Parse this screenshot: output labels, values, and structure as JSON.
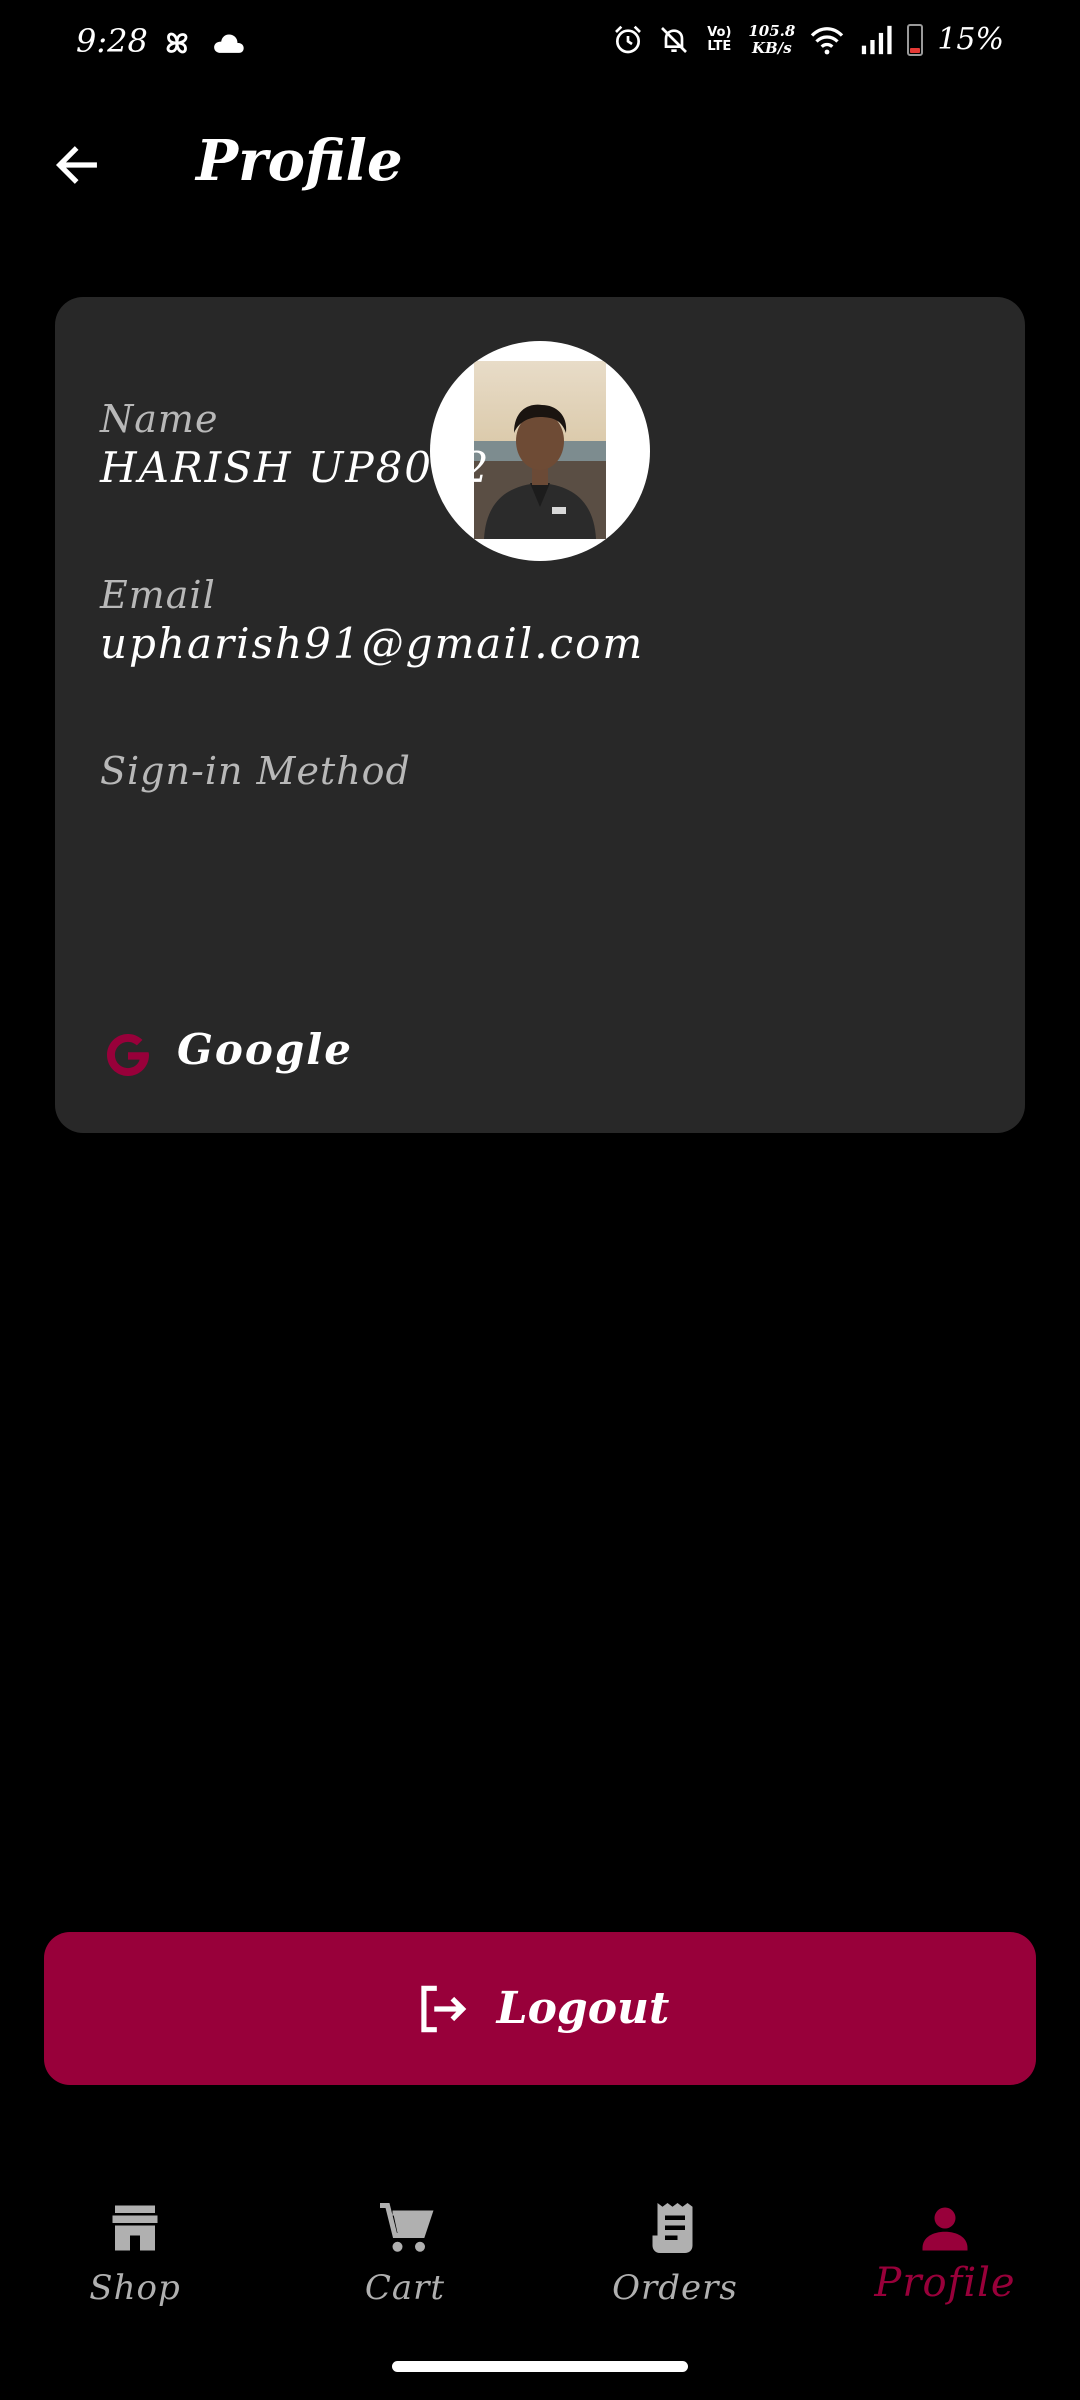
{
  "status_bar": {
    "time": "9:28",
    "network_speed_value": "105.8",
    "network_speed_unit": "KB/s",
    "network_type": "Vo) LTE",
    "battery_percent": "15%",
    "battery_level": 0.15
  },
  "header": {
    "title": "Profile",
    "back_icon": "arrow-left-icon"
  },
  "profile": {
    "avatar_icon": "user-photo",
    "name_label": "Name",
    "name_value": "HARISH UP8072",
    "email_label": "Email",
    "email_value": "upharish91@gmail.com",
    "signin_label": "Sign-in Method",
    "signin_value": "Google",
    "signin_icon": "google-icon"
  },
  "logout": {
    "label": "Logout",
    "icon": "logout-icon"
  },
  "bottom_nav": {
    "items": [
      {
        "label": "Shop",
        "icon": "store-icon",
        "active": false
      },
      {
        "label": "Cart",
        "icon": "cart-icon",
        "active": false
      },
      {
        "label": "Orders",
        "icon": "receipt-icon",
        "active": false
      },
      {
        "label": "Profile",
        "icon": "person-icon",
        "active": true
      }
    ]
  },
  "colors": {
    "accent": "#98003a",
    "card_background": "#282828",
    "background": "#000000",
    "label_gray": "#b8b8b8",
    "inactive_nav": "#b0b0b0"
  }
}
